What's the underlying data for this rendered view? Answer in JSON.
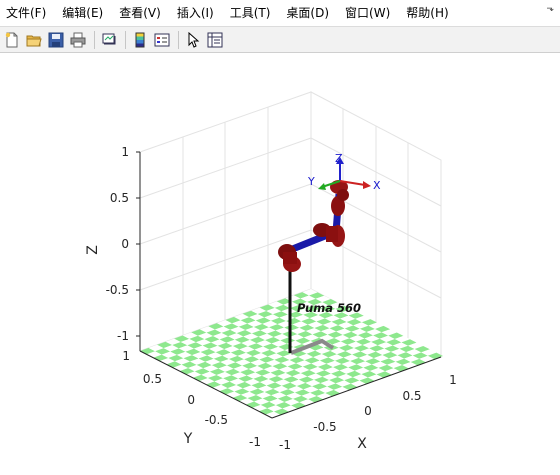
{
  "menu": {
    "items": [
      "文件(F)",
      "编辑(E)",
      "查看(V)",
      "插入(I)",
      "工具(T)",
      "桌面(D)",
      "窗口(W)",
      "帮助(H)"
    ],
    "pin_glyph": "⬎"
  },
  "toolbar": {
    "buttons": [
      "new-figure-icon",
      "open-file-icon",
      "save-icon",
      "print-icon",
      "link-plot-icon",
      "insert-colorbar-icon",
      "insert-legend-icon",
      "edit-plot-arrow-icon",
      "property-inspector-icon"
    ]
  },
  "plot": {
    "x_label": "X",
    "y_label": "Y",
    "z_label": "Z",
    "x_ticks": [
      "-1",
      "-0.5",
      "0",
      "0.5",
      "1"
    ],
    "y_ticks": [
      "-1",
      "-0.5",
      "0",
      "0.5",
      "1"
    ],
    "z_ticks": [
      "-1",
      "-0.5",
      "0",
      "0.5",
      "1"
    ],
    "robot_name": "Puma 560",
    "frame_labels": {
      "x": "X",
      "y": "Y",
      "z": "Z"
    },
    "colors": {
      "link": "#1a1aa8",
      "joint": "#8b1010",
      "floor_a": "#8ee88e",
      "floor_b": "#ffffff",
      "shadow": "#888888",
      "frame_x": "#cc2222",
      "frame_y": "#22aa22",
      "frame_z": "#2222cc",
      "frame_text": "#1a1acc"
    }
  }
}
